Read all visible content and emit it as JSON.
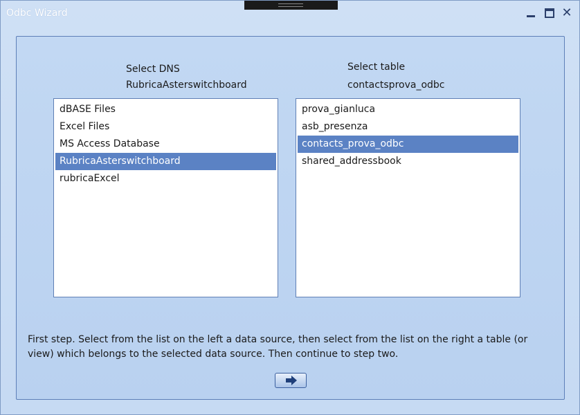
{
  "window": {
    "title": "Odbc Wizard"
  },
  "dns": {
    "label": "Select DNS",
    "current": "RubricaAsterswitchboard",
    "items": [
      {
        "label": "dBASE Files",
        "selected": false
      },
      {
        "label": "Excel Files",
        "selected": false
      },
      {
        "label": "MS Access Database",
        "selected": false
      },
      {
        "label": "RubricaAsterswitchboard",
        "selected": true
      },
      {
        "label": "rubricaExcel",
        "selected": false
      }
    ]
  },
  "table": {
    "label": "Select table",
    "current": "contactsprova_odbc",
    "items": [
      {
        "label": "prova_gianluca",
        "selected": false
      },
      {
        "label": "asb_presenza",
        "selected": false
      },
      {
        "label": "contacts_prova_odbc",
        "selected": true
      },
      {
        "label": "shared_addressbook",
        "selected": false
      }
    ]
  },
  "help_text": "First step. Select from the list on the left a data source, then select from the list on the right a table (or view) which belongs to the selected data source. Then continue to step two.",
  "buttons": {
    "next_icon": "arrow-right-icon"
  },
  "colors": {
    "selection": "#5b82c4",
    "panel_border": "#5d7fb8"
  }
}
